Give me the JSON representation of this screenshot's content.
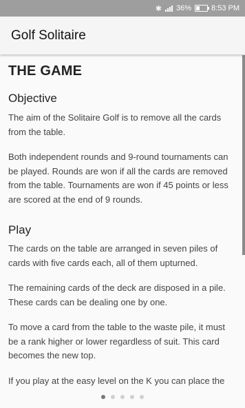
{
  "status_bar": {
    "battery_text": "36%",
    "battery_level": 0.36,
    "time": "8:53 PM",
    "icons": [
      "bluetooth-icon",
      "signal-icon",
      "battery-icon"
    ]
  },
  "app_bar": {
    "title": "Golf Solitaire"
  },
  "article": {
    "heading": "THE GAME",
    "sections": [
      {
        "title": "Objective",
        "paragraphs": [
          "The aim of the Solitaire Golf is to remove all the cards from the table.",
          "Both independent rounds and 9-round tournaments can be played. Rounds are won if all the cards are removed from the table. Tournaments are won if 45 points or less are scored at the end of 9 rounds."
        ]
      },
      {
        "title": "Play",
        "paragraphs": [
          "The cards on the table are arranged in seven piles of cards with five cards each, all of them upturned.",
          "The remaining cards of the deck are disposed in a pile. These cards can be dealing one by one.",
          "To move a card from the table to the waste pile, it must be a rank higher or lower regardless of suit. This card becomes the new top.",
          "If you play at the easy level on the K you can place the"
        ]
      }
    ]
  },
  "pager": {
    "page_count": 5,
    "active_page": 1
  },
  "colors": {
    "status_bar": "#9e9e9e",
    "app_bar": "#f5f5f5",
    "background": "#fafafa",
    "active_dot": "#777777",
    "inactive_dot": "#cfcfcf"
  }
}
